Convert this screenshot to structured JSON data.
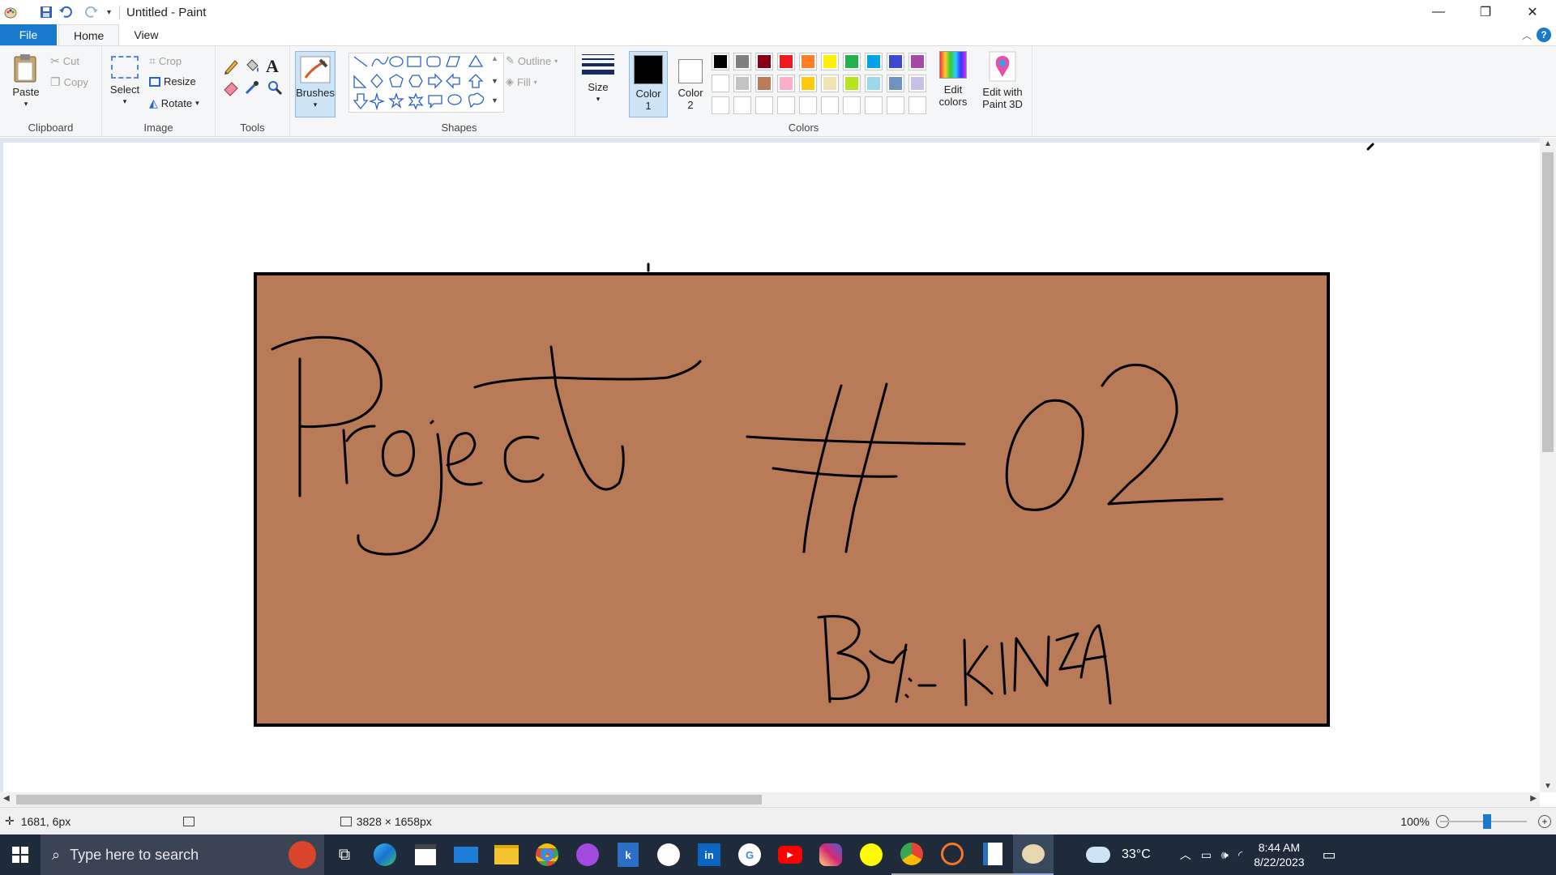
{
  "window": {
    "title": "Untitled - Paint"
  },
  "tabs": [
    {
      "label": "File"
    },
    {
      "label": "Home"
    },
    {
      "label": "View"
    }
  ],
  "help_label": "?",
  "ribbon": {
    "clipboard": {
      "paste": "Paste",
      "cut": "Cut",
      "copy": "Copy",
      "label": "Clipboard"
    },
    "image": {
      "select": "Select",
      "crop": "Crop",
      "resize": "Resize",
      "rotate": "Rotate",
      "label": "Image"
    },
    "tools": {
      "label": "Tools"
    },
    "brushes": {
      "label": "Brushes"
    },
    "shapes": {
      "outline": "Outline",
      "fill": "Fill",
      "label": "Shapes"
    },
    "size": {
      "label": "Size"
    },
    "colors": {
      "color1": "Color 1",
      "color1_num": "1",
      "color2": "Color 2",
      "color2_num": "2",
      "edit_colors_1": "Edit",
      "edit_colors_2": "colors",
      "edit_3d_1": "Edit with",
      "edit_3d_2": "Paint 3D",
      "label": "Colors",
      "color1_value": "#000000",
      "color2_value": "#ffffff",
      "palette_row1": [
        "#000000",
        "#7f7f7f",
        "#880015",
        "#ed1c24",
        "#ff7f27",
        "#fff200",
        "#22b14c",
        "#00a2e8",
        "#3f48cc",
        "#a349a4"
      ],
      "palette_row2": [
        "#ffffff",
        "#c3c3c3",
        "#b97a57",
        "#ffaec9",
        "#ffc90e",
        "#efe4b0",
        "#b5e61d",
        "#99d9ea",
        "#7092be",
        "#c8bfe7"
      ]
    }
  },
  "drawing": {
    "background": "#b97a57",
    "stroke": "#000000",
    "title_text": "Project # 02",
    "byline_text": "By:- KINZA"
  },
  "status": {
    "cursor_pos": "1681, 6px",
    "image_size": "3828 × 1658px",
    "zoom": "100%"
  },
  "taskbar": {
    "search_placeholder": "Type here to search",
    "weather": "33°C",
    "time": "8:44 AM",
    "date": "8/22/2023"
  }
}
